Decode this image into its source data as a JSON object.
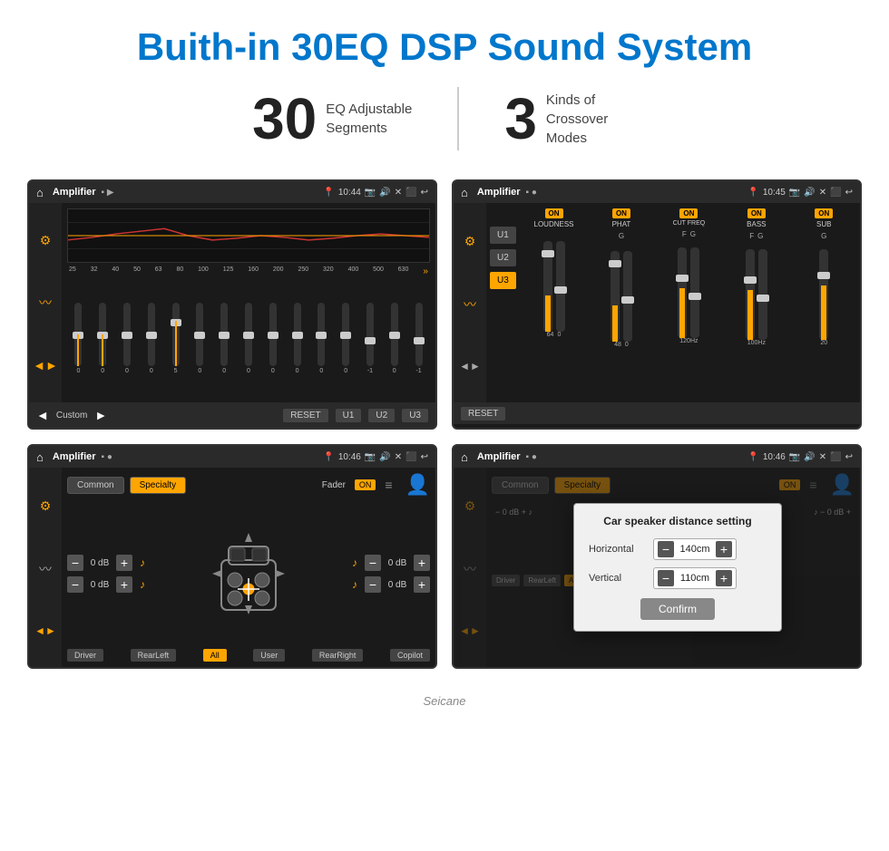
{
  "page": {
    "title": "Buith-in 30EQ DSP Sound System",
    "brand": "Seicane",
    "stats": [
      {
        "number": "30",
        "label": "EQ Adjustable\nSegments"
      },
      {
        "number": "3",
        "label": "Kinds of\nCrossover Modes"
      }
    ]
  },
  "screen1": {
    "app_name": "Amplifier",
    "time": "10:44",
    "eq_freqs": [
      "25",
      "32",
      "40",
      "50",
      "63",
      "80",
      "100",
      "125",
      "160",
      "200",
      "250",
      "320",
      "400",
      "500",
      "630"
    ],
    "eq_values": [
      "0",
      "0",
      "0",
      "0",
      "5",
      "0",
      "0",
      "0",
      "0",
      "0",
      "0",
      "0",
      "-1",
      "0",
      "-1"
    ],
    "preset_label": "Custom",
    "buttons": [
      "RESET",
      "U1",
      "U2",
      "U3"
    ]
  },
  "screen2": {
    "app_name": "Amplifier",
    "time": "10:45",
    "channels": [
      "LOUDNESS",
      "PHAT",
      "CUT FREQ",
      "BASS",
      "SUB"
    ],
    "active_preset": "U3",
    "reset_label": "RESET"
  },
  "screen3": {
    "app_name": "Amplifier",
    "time": "10:46",
    "mode_common": "Common",
    "mode_specialty": "Specialty",
    "fader_label": "Fader",
    "fader_state": "ON",
    "positions": [
      "Driver",
      "RearLeft",
      "All",
      "User",
      "RearRight",
      "Copilot"
    ],
    "db_values": [
      "0 dB",
      "0 dB",
      "0 dB",
      "0 dB"
    ]
  },
  "screen4": {
    "app_name": "Amplifier",
    "time": "10:46",
    "dialog": {
      "title": "Car speaker distance setting",
      "horizontal_label": "Horizontal",
      "horizontal_value": "140cm",
      "vertical_label": "Vertical",
      "vertical_value": "110cm",
      "confirm_label": "Confirm"
    }
  }
}
